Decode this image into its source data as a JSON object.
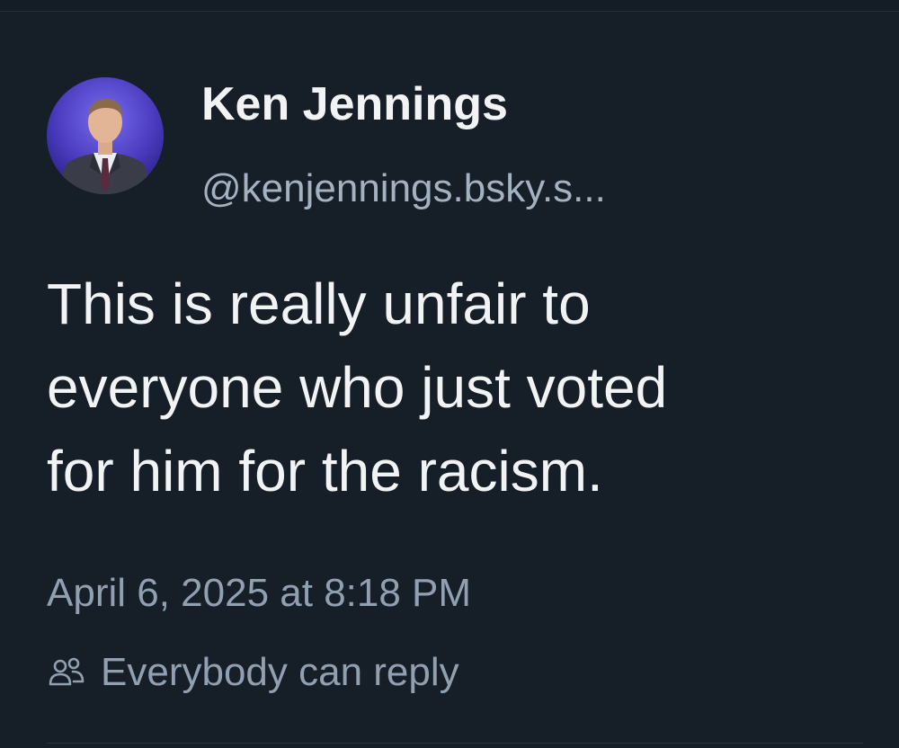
{
  "post": {
    "author": {
      "display_name": "Ken Jennings",
      "handle": "@kenjennings.bsky.s...",
      "avatar_icon": "profile-photo"
    },
    "text_lines": [
      "This is really unfair to",
      "everyone who just voted",
      "for him for the racism."
    ],
    "timestamp": "April 6, 2025 at 8:18 PM",
    "reply_setting": {
      "icon": "people-icon",
      "label": "Everybody can reply"
    }
  },
  "colors": {
    "background": "#161e27",
    "primary_text": "#f1f3f5",
    "secondary_text": "#91a0b0",
    "avatar_background": "#3b2f8f"
  }
}
